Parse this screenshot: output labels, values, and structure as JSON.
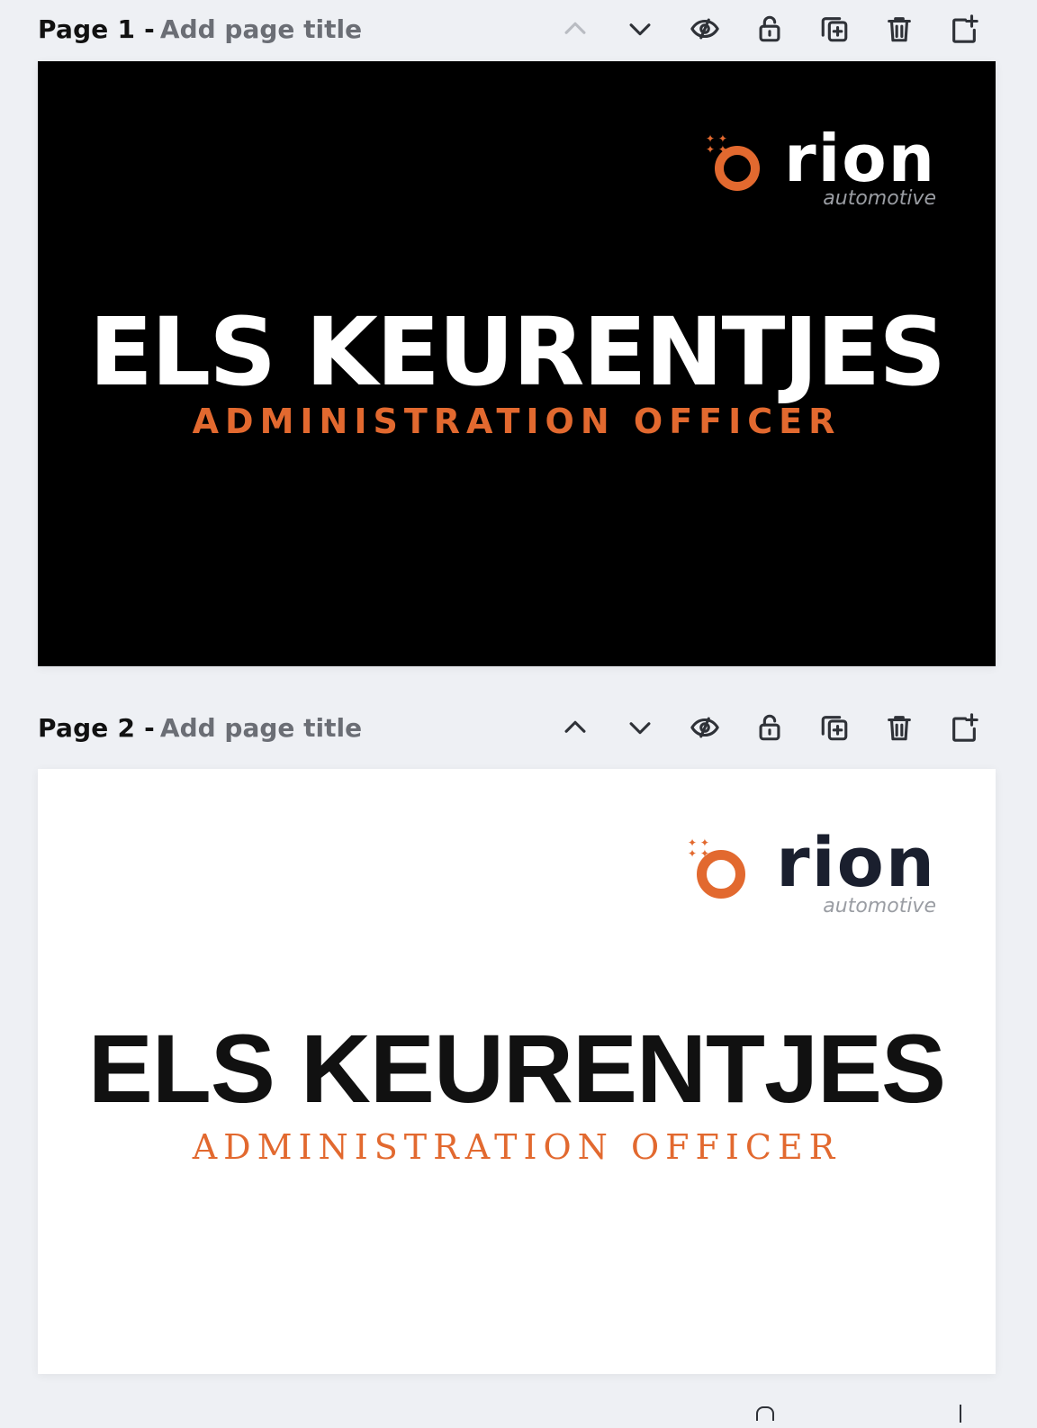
{
  "pages": [
    {
      "label": "Page 1 -",
      "title_placeholder": "Add page title",
      "theme": "dark",
      "logo": {
        "word": "orion",
        "sub": "automotive"
      },
      "name": "ELS KEURENTJES",
      "role": "ADMINISTRATION OFFICER",
      "move_up_enabled": false
    },
    {
      "label": "Page 2 -",
      "title_placeholder": "Add page title",
      "theme": "light",
      "logo": {
        "word": "orion",
        "sub": "automotive"
      },
      "name": "ELS KEURENTJES",
      "role": "ADMINISTRATION OFFICER",
      "move_up_enabled": true
    }
  ],
  "toolbar_icons": [
    "chevron-up-icon",
    "chevron-down-icon",
    "hide-eye-icon",
    "lock-icon",
    "duplicate-page-icon",
    "trash-icon",
    "add-page-icon"
  ],
  "colors": {
    "accent": "#e2692f",
    "background": "#eef0f4",
    "dark_canvas": "#000000",
    "light_canvas": "#ffffff",
    "logo_white": "#ffffff",
    "logo_navy": "#1a1f2e"
  }
}
